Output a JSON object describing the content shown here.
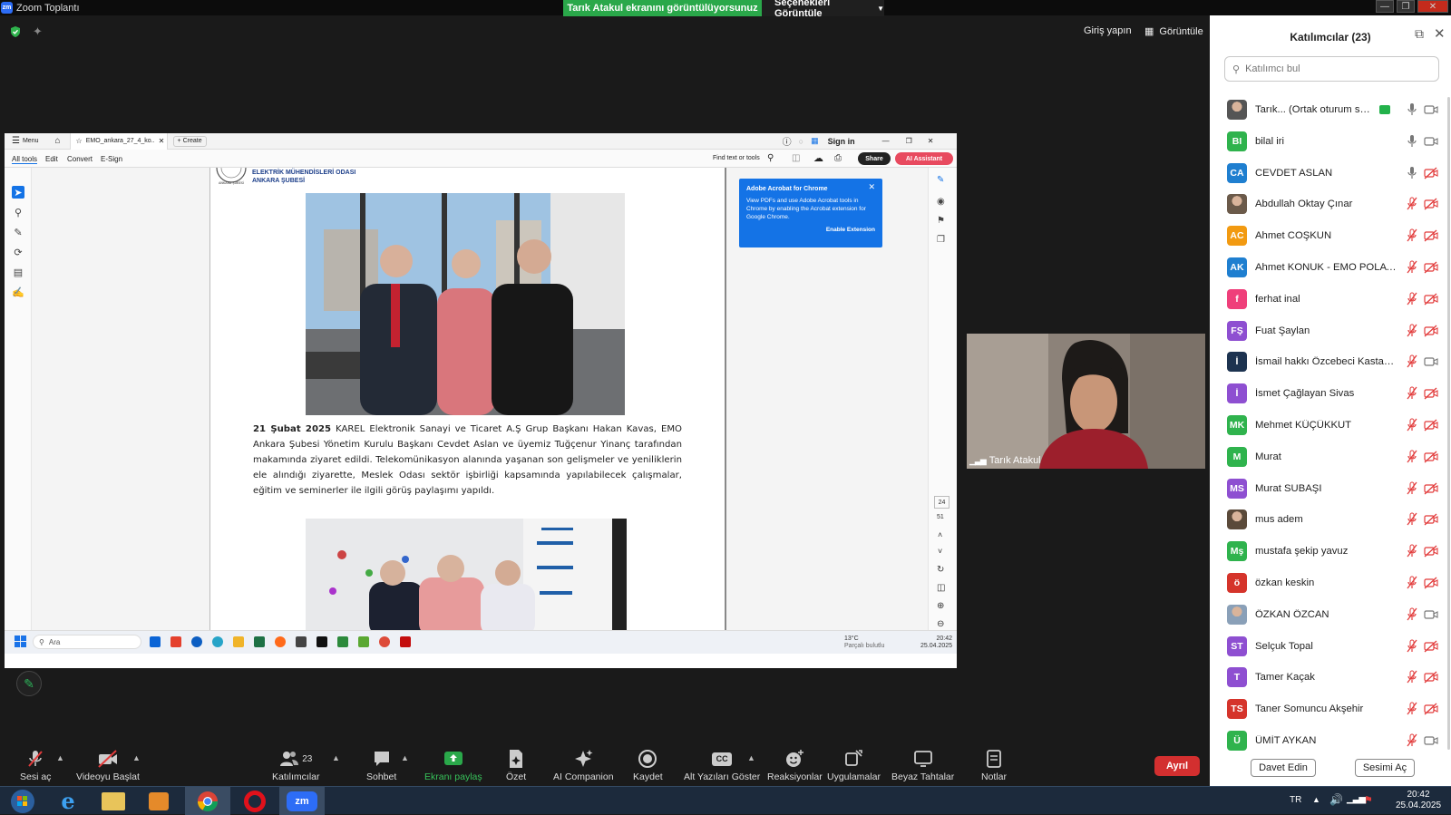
{
  "window": {
    "title": "Zoom Toplantı",
    "logo": "zm"
  },
  "share_banner": {
    "text": "Tarık Atakul ekranını görüntülüyorsunuz",
    "options": "Seçenekleri Görüntüle"
  },
  "top_bar": {
    "signin": "Giriş yapın",
    "view": "Görüntüle"
  },
  "shared_screen": {
    "menu": "Menu",
    "tab_title": "EMO_ankara_27_4_ko..",
    "create": "Create",
    "signin": "Sign in",
    "tools": [
      "All tools",
      "Edit",
      "Convert",
      "E-Sign"
    ],
    "find": "Find text or tools",
    "share": "Share",
    "ai_assistant": "AI Assistant",
    "org_line1": "ELEKTRİK MÜHENDİSLERİ ODASI",
    "org_line2": "ANKARA ŞUBESİ",
    "caption_date": "21 Şubat 2025",
    "caption_text": " KAREL Elektronik Sanayi ve Ticaret A.Ş Grup Başkanı Hakan Kavas, EMO Ankara Şubesi Yönetim Kurulu Başkanı Cevdet Aslan ve üyemiz Tuğçenur Yinanç tarafından makamında ziyaret edildi. Telekomünikasyon alanında yaşanan son gelişmeler ve yeniliklerin ele alındığı ziyarette, Meslek Odası sektör işbirliği kapsamında yapılabilecek çalışmalar, eğitim ve seminerler ile ilgili görüş paylaşımı yapıldı.",
    "popup_title": "Adobe Acrobat for Chrome",
    "popup_body": "View PDFs and use Adobe Acrobat tools in Chrome by enabling the Acrobat extension for Google Chrome.",
    "popup_action": "Enable Extension",
    "page_current": "24",
    "page_total": "51",
    "inner_search": "Ara",
    "inner_weather_temp": "13°C",
    "inner_weather_text": "Parçalı bulutlu",
    "inner_time": "20:42",
    "inner_date": "25.04.2025"
  },
  "video": {
    "name": "Tarık Atakul"
  },
  "panel": {
    "title": "Katılımcılar (23)",
    "search_placeholder": "Katılımcı bul",
    "invite": "Davet Edin",
    "mute_me": "Sesimi Aç",
    "participants": [
      {
        "name": "Tarık... (Ortak oturum sahibi)",
        "initials": "",
        "color": "#555555",
        "mic": "on",
        "cam": "on"
      },
      {
        "name": "bilal iri",
        "initials": "BI",
        "color": "#2fb34d",
        "mic": "on",
        "cam": "on"
      },
      {
        "name": "CEVDET ASLAN",
        "initials": "CA",
        "color": "#1f7fd0",
        "mic": "on",
        "cam": "off"
      },
      {
        "name": "Abdullah Oktay Çınar",
        "initials": "",
        "color": "#6b5a4a",
        "mic": "off",
        "cam": "off"
      },
      {
        "name": "Ahmet COŞKUN",
        "initials": "AC",
        "color": "#f29a11",
        "mic": "off",
        "cam": "off"
      },
      {
        "name": "Ahmet KONUK - EMO POLATLI",
        "initials": "AK",
        "color": "#1f7fd0",
        "mic": "off",
        "cam": "off"
      },
      {
        "name": "ferhat inal",
        "initials": "f",
        "color": "#ef3f7a",
        "mic": "off",
        "cam": "off"
      },
      {
        "name": "Fuat Şaylan",
        "initials": "FŞ",
        "color": "#8e4fd1",
        "mic": "off",
        "cam": "off"
      },
      {
        "name": "İsmail hakkı Özcebeci Kastamo...",
        "initials": "İ",
        "color": "#1d3350",
        "mic": "off",
        "cam": "on"
      },
      {
        "name": "İsmet Çağlayan Sivas",
        "initials": "İ",
        "color": "#8e4fd1",
        "mic": "off",
        "cam": "off"
      },
      {
        "name": "Mehmet KÜÇÜKKUT",
        "initials": "MK",
        "color": "#2fb34d",
        "mic": "off",
        "cam": "off"
      },
      {
        "name": "Murat",
        "initials": "M",
        "color": "#2fb34d",
        "mic": "off",
        "cam": "off"
      },
      {
        "name": "Murat SUBAŞI",
        "initials": "MS",
        "color": "#8e4fd1",
        "mic": "off",
        "cam": "off"
      },
      {
        "name": "mus adem",
        "initials": "",
        "color": "#5b4a3a",
        "mic": "off",
        "cam": "off"
      },
      {
        "name": "mustafa şekip yavuz",
        "initials": "Mş",
        "color": "#2fb34d",
        "mic": "off",
        "cam": "off"
      },
      {
        "name": "özkan keskin",
        "initials": "ö",
        "color": "#d5342b",
        "mic": "off",
        "cam": "off"
      },
      {
        "name": "ÖZKAN ÖZCAN",
        "initials": "",
        "color": "#8aa0b8",
        "mic": "off",
        "cam": "on"
      },
      {
        "name": "Selçuk Topal",
        "initials": "ST",
        "color": "#8e4fd1",
        "mic": "off",
        "cam": "off"
      },
      {
        "name": "Tamer Kaçak",
        "initials": "T",
        "color": "#8e4fd1",
        "mic": "off",
        "cam": "off"
      },
      {
        "name": "Taner Somuncu Akşehir",
        "initials": "TS",
        "color": "#d5342b",
        "mic": "off",
        "cam": "off"
      },
      {
        "name": "ÜMİT AYKAN",
        "initials": "Ü",
        "color": "#2fb34d",
        "mic": "off",
        "cam": "on"
      }
    ]
  },
  "toolbar": {
    "audio": "Sesi aç",
    "video": "Videoyu Başlat",
    "participants": "Katılımcılar",
    "participants_count": "23",
    "chat": "Sohbet",
    "share": "Ekranı paylaş",
    "summary": "Özet",
    "ai": "AI Companion",
    "record": "Kaydet",
    "captions": "Alt Yazıları Göster",
    "reactions": "Reaksiyonlar",
    "apps": "Uygulamalar",
    "whiteboards": "Beyaz Tahtalar",
    "notes": "Notlar",
    "leave": "Ayrıl",
    "cc": "CC"
  },
  "taskbar": {
    "lang": "TR",
    "time": "20:42",
    "date": "25.04.2025"
  },
  "colors": {
    "accent_green": "#2aa84a",
    "leave_red": "#d32f2f",
    "acrobat_blue": "#1473e6",
    "off_red": "#e23b3b"
  }
}
